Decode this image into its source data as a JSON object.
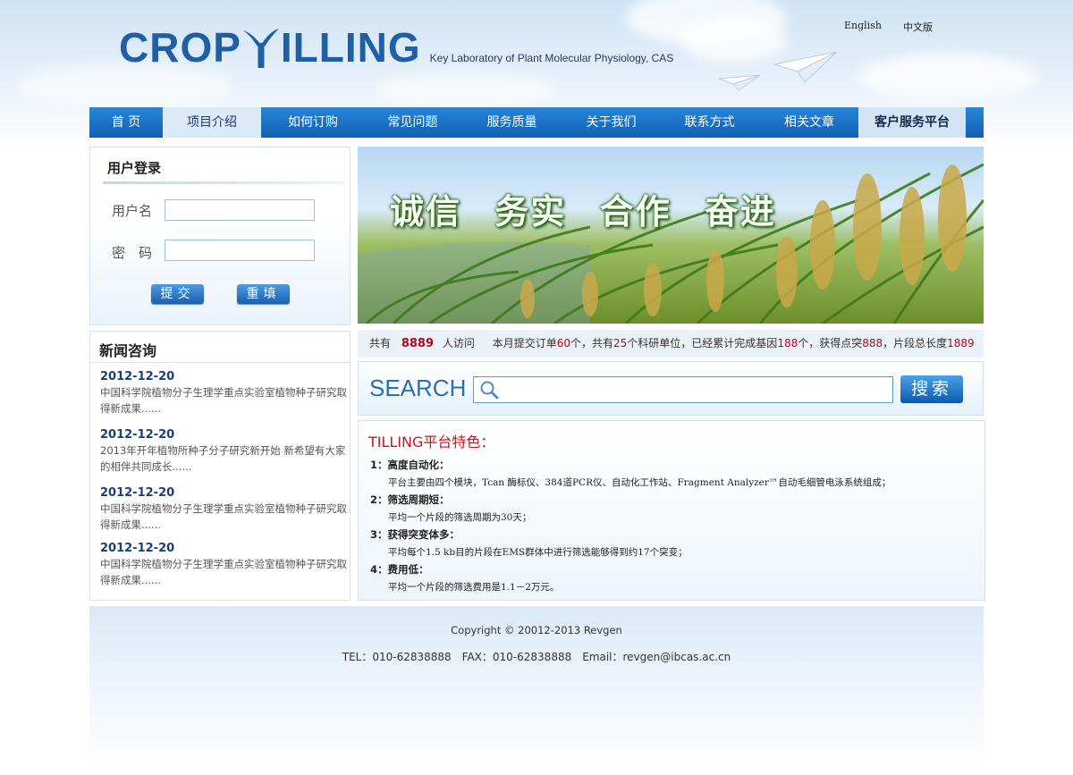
{
  "header": {
    "logo": "CROP TILLING",
    "logo_left": "CROP",
    "logo_right": "ILLING",
    "lab_name": "Key Laboratory of Plant Molecular Physiology, CAS",
    "lang_en": "English",
    "lang_cn": "中文版"
  },
  "nav": {
    "items": [
      "首 页",
      "项目介绍",
      "如何订购",
      "常见问题",
      "服务质量",
      "关于我们",
      "联系方式",
      "相关文章"
    ],
    "active_index": 1,
    "right": "客户服务平台"
  },
  "login": {
    "title": "用户登录",
    "username_label": "用户名",
    "password_label": "密　码",
    "submit": "提交",
    "reset": "重填"
  },
  "banner": {
    "slogan": [
      "诚信",
      "务实",
      "合作",
      "奋进"
    ]
  },
  "stats": {
    "visit_prefix": "共有",
    "visit_count": "8889",
    "visit_suffix": "人访问",
    "orders_prefix": "本月提交订单",
    "orders": "60",
    "orders_unit": "个，共有",
    "units": "25",
    "units_suffix": "个科研单位，已经累计完成基因",
    "genes": "188",
    "genes_suffix": "个，获得点突",
    "mutations": "888",
    "length_prefix": "，片段总长度",
    "length": "1889"
  },
  "search": {
    "label": "SEARCH",
    "placeholder": "",
    "button": "搜索"
  },
  "news": {
    "title": "新闻咨询",
    "items": [
      {
        "date": "2012-12-20",
        "text": "中国科学院植物分子生理学重点实验室植物种子研究取得新成果......"
      },
      {
        "date": "2012-12-20",
        "text": "2013年开年植物所种子分子研究新开始 新希望有大家的相伴共同成长......"
      },
      {
        "date": "2012-12-20",
        "text": "中国科学院植物分子生理学重点实验室植物种子研究取得新成果......"
      },
      {
        "date": "2012-12-20",
        "text": "中国科学院植物分子生理学重点实验室植物种子研究取得新成果......"
      }
    ]
  },
  "features": {
    "title": "TILLING平台特色：",
    "items": [
      {
        "heading": "1：高度自动化：",
        "text": "平台主要由四个模块，Tcan 酶标仪、384道PCR仪、自动化工作站、Fragment Analyzer™自动毛细管电泳系统组成；"
      },
      {
        "heading": "2：筛选周期短：",
        "text": "平均一个片段的筛选周期为30天；"
      },
      {
        "heading": "3：获得突变体多：",
        "text": "平均每个1.5 kb目的片段在EMS群体中进行筛选能够得到约17个突变；"
      },
      {
        "heading": "4：费用低：",
        "text": "平均一个片段的筛选费用是1.1－2万元。"
      }
    ]
  },
  "footer": {
    "copyright": "Copyright © 20012-2013 Revgen",
    "contact": "TEL：010-62838888　FAX：010-62838888　Email：revgen@ibcas.ac.cn"
  },
  "colors": {
    "nav_blue": "#1f72c8",
    "logo_blue": "#1f5fa8",
    "accent_red": "#b5081a"
  }
}
